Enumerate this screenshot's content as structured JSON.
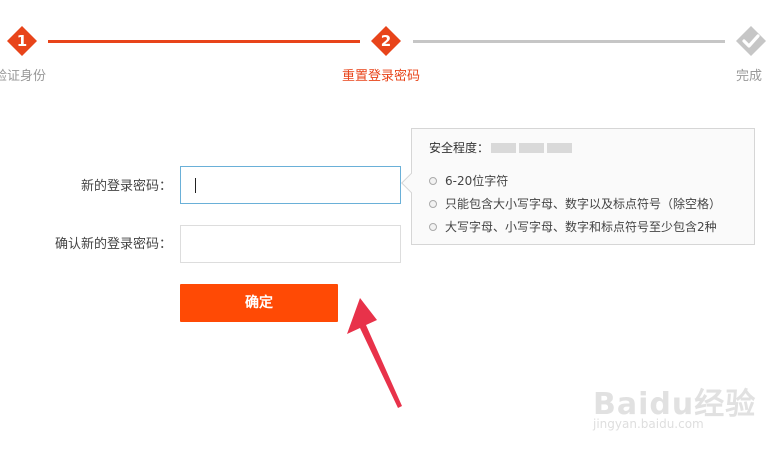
{
  "steps": [
    {
      "number": "1",
      "label": "验证身份",
      "state": "done",
      "color": "#e8441a"
    },
    {
      "number": "2",
      "label": "重置登录密码",
      "state": "current",
      "color": "#e8441a"
    },
    {
      "number": "",
      "label": "完成",
      "state": "pending",
      "color": "#c6c6c6"
    }
  ],
  "form": {
    "new_password_label": "新的登录密码：",
    "new_password_value": "",
    "confirm_password_label": "确认新的登录密码：",
    "confirm_password_value": "",
    "submit_label": "确定"
  },
  "tooltip": {
    "strength_label": "安全程度：",
    "rules": [
      "6-20位字符",
      "只能包含大小写字母、数字以及标点符号（除空格）",
      "大写字母、小写字母、数字和标点符号至少包含2种"
    ]
  },
  "watermark": {
    "brand": "Baidu经验",
    "url": "jingyan.baidu.com"
  },
  "colors": {
    "accent": "#e8441a",
    "button": "#ff4a05",
    "inactive": "#c6c6c6",
    "annotation_arrow": "#e8324a"
  }
}
